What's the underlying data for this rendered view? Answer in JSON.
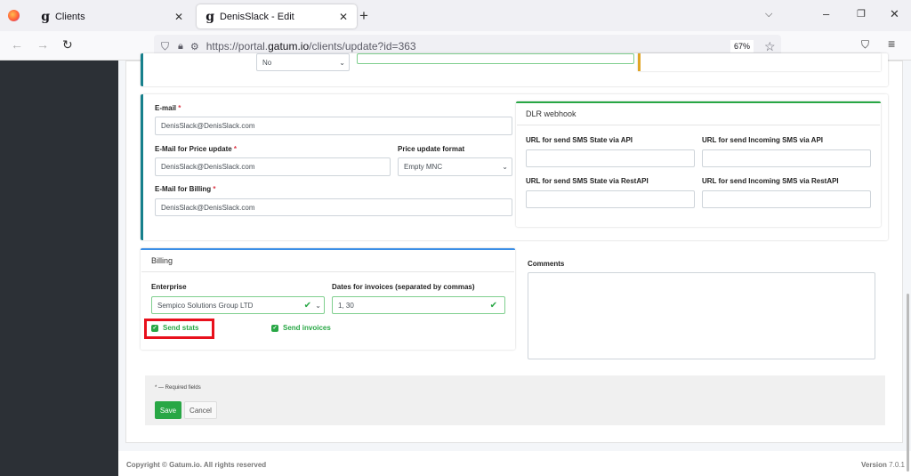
{
  "browser": {
    "tabs": [
      {
        "label": "Clients"
      },
      {
        "label": "DenisSlack - Edit"
      }
    ],
    "url_prefix": "https://portal.",
    "url_domain": "gatum.io",
    "url_path": "/clients/update?id=363",
    "zoom": "67%"
  },
  "top": {
    "select_value": "No"
  },
  "contact": {
    "email_label": "E-mail",
    "email_value": "DenisSlack@DenisSlack.com",
    "price_email_label": "E-Mail for Price update",
    "price_email_value": "DenisSlack@DenisSlack.com",
    "price_format_label": "Price update format",
    "price_format_value": "Empty MNC",
    "billing_email_label": "E-Mail for Billing",
    "billing_email_value": "DenisSlack@DenisSlack.com",
    "required_mark": "*"
  },
  "dlr": {
    "title": "DLR webhook",
    "fields": [
      {
        "label": "URL for send SMS State via API",
        "value": ""
      },
      {
        "label": "URL for send Incoming SMS via API",
        "value": ""
      },
      {
        "label": "URL for send SMS State via RestAPI",
        "value": ""
      },
      {
        "label": "URL for send Incoming SMS via RestAPI",
        "value": ""
      }
    ]
  },
  "billing": {
    "title": "Billing",
    "enterprise_label": "Enterprise",
    "enterprise_value": "Sempico Solutions Group LTD",
    "dates_label": "Dates for invoices (separated by commas)",
    "dates_value": "1, 30",
    "send_stats": "Send stats",
    "send_stats_checked": true,
    "send_invoices": "Send invoices",
    "send_invoices_checked": true
  },
  "comments": {
    "label": "Comments",
    "value": ""
  },
  "form": {
    "required_note": "* — Required fields",
    "save": "Save",
    "cancel": "Cancel"
  },
  "footer": {
    "copyright": "Copyright © Gatum.io. All rights reserved",
    "version_label": "Version",
    "version": "7.0.1"
  },
  "colors": {
    "success": "#28a745",
    "highlight": "#e8101c",
    "sidebar": "#2c3036"
  }
}
